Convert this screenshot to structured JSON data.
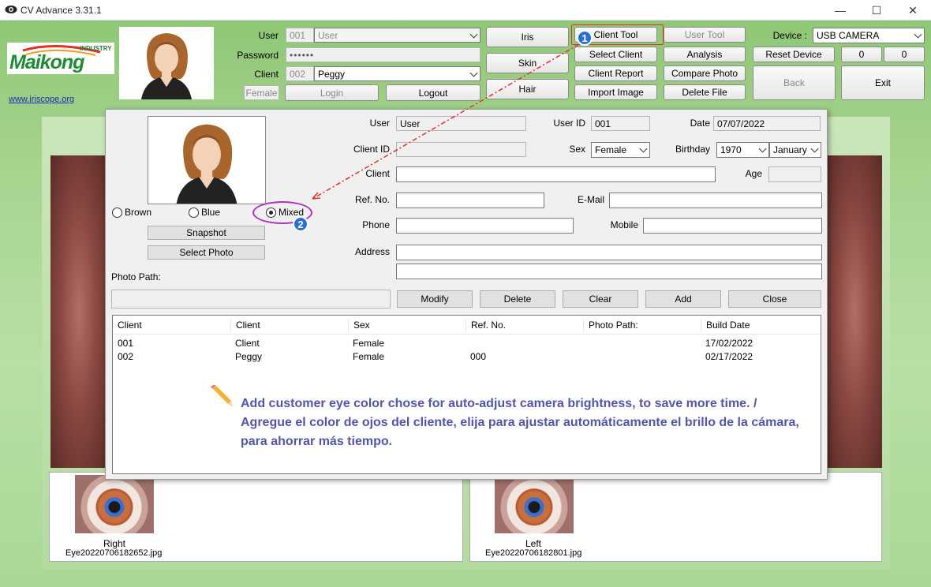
{
  "app": {
    "title": "CV Advance 3.31.1",
    "icon": "eye-app-icon"
  },
  "window_controls": {
    "minimize": "—",
    "maximize": "☐",
    "close": "✕"
  },
  "logo": {
    "brand": "Maikong",
    "industry": "INDUSTRY",
    "link": "www.iriscope.org"
  },
  "login": {
    "user_label": "User",
    "user_code": "001",
    "user_value": "User",
    "password_label": "Password",
    "password_value": "••••••",
    "client_label": "Client",
    "client_code": "002",
    "client_value": "Peggy",
    "gender": "Female",
    "login_btn": "Login",
    "logout_btn": "Logout"
  },
  "modes": {
    "iris": "Iris",
    "skin": "Skin",
    "hair": "Hair"
  },
  "tools": {
    "client_tool": "Client Tool",
    "user_tool": "User Tool",
    "select_client": "Select Client",
    "analysis": "Analysis",
    "client_report": "Client Report",
    "compare_photo": "Compare Photo",
    "import_image": "Import Image",
    "delete_file": "Delete File"
  },
  "device": {
    "label": "Device :",
    "value": "USB CAMERA",
    "reset": "Reset Device",
    "count1": "0",
    "count2": "0",
    "back": "Back",
    "exit": "Exit"
  },
  "callouts": {
    "one": "1",
    "two": "2"
  },
  "dialog": {
    "radio_brown": "Brown",
    "radio_blue": "Blue",
    "radio_mixed": "Mixed",
    "snapshot": "Snapshot",
    "select_photo": "Select Photo",
    "photo_path_label": "Photo Path:",
    "user_label": "User",
    "user_value": "User",
    "user_id_label": "User ID",
    "user_id_value": "001",
    "date_label": "Date",
    "date_value": "07/07/2022",
    "client_id_label": "Client ID",
    "client_id_value": "",
    "sex_label": "Sex",
    "sex_value": "Female",
    "birthday_label": "Birthday",
    "birthday_year": "1970",
    "birthday_month": "January",
    "client_label": "Client",
    "age_label": "Age",
    "ref_label": "Ref. No.",
    "email_label": "E-Mail",
    "phone_label": "Phone",
    "mobile_label": "Mobile",
    "address_label": "Address",
    "modify": "Modify",
    "delete": "Delete",
    "clear": "Clear",
    "add": "Add",
    "close": "Close"
  },
  "table": {
    "columns": [
      "Client",
      "Client",
      "Sex",
      "Ref. No.",
      "Photo Path:",
      "Build Date"
    ],
    "rows": [
      [
        "001",
        "Client",
        "Female",
        "",
        "",
        "17/02/2022"
      ],
      [
        "002",
        "Peggy",
        "Female",
        "000",
        "",
        "02/17/2022"
      ]
    ]
  },
  "note": {
    "icon": "pencil-icon",
    "line1": "Add customer eye color chose for auto-adjust camera brightness, to save more time. /",
    "line2": "Agregue el color de ojos del cliente, elija para ajustar automáticamente el brillo de la cámara,",
    "line3": "para ahorrar más tiempo."
  },
  "thumbs": {
    "right_label": "Right",
    "right_file": "Eye20220706182652.jpg",
    "left_label": "Left",
    "left_file": "Eye20220706182801.jpg"
  },
  "colors": {
    "accent_red": "#e0302a",
    "callout_blue": "#2a6fd6",
    "mixed_ring": "#b12fc3",
    "note": "#5356a6"
  }
}
